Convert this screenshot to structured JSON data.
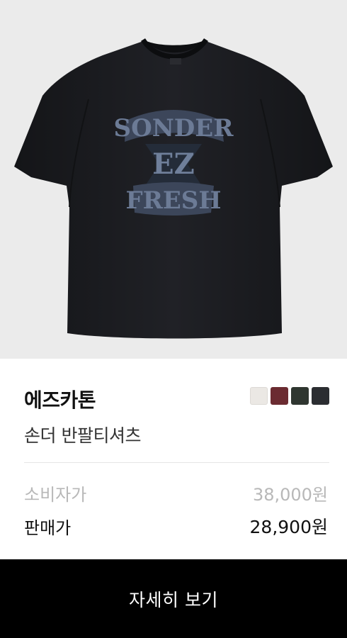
{
  "product_image": {
    "graphic_text_top": "SONDER",
    "graphic_text_bottom": "FRESH",
    "graphic_monogram": "EZ",
    "shirt_color": "#1b1c1f",
    "print_color": "#5d6a82",
    "background_color": "#ebebeb"
  },
  "card": {
    "brand": "에즈카톤",
    "product_name": "손더 반팔티셔츠",
    "color_swatches": [
      {
        "name": "ivory",
        "color": "#ebe8e4"
      },
      {
        "name": "burgundy",
        "color": "#6b2b31"
      },
      {
        "name": "dark-green",
        "color": "#2f3630"
      },
      {
        "name": "charcoal",
        "color": "#2b2d31"
      }
    ],
    "consumer_price_label": "소비자가",
    "consumer_price_value": "38,000원",
    "sale_price_label": "판매가",
    "sale_price_value": "28,900원"
  },
  "cta": {
    "label": "자세히 보기"
  }
}
